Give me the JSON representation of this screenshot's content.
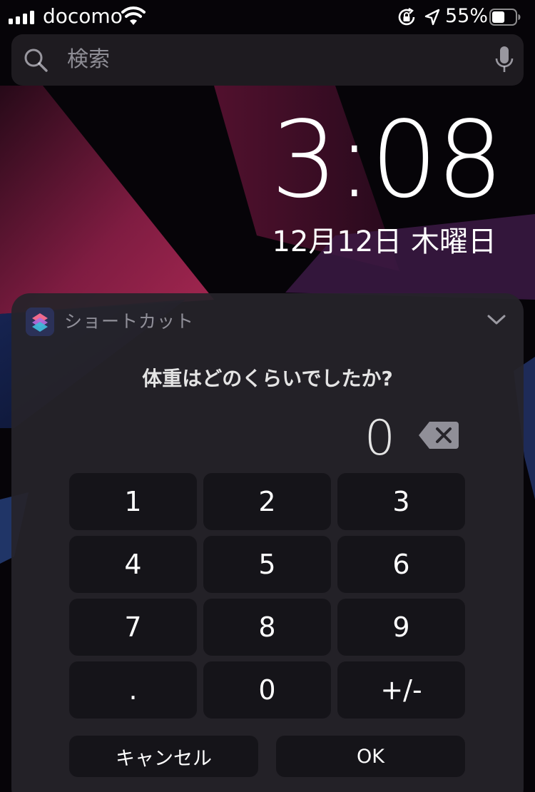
{
  "status_bar": {
    "carrier": "docomo",
    "battery_percent": "55%",
    "battery_level": 0.55,
    "signal_bars": 4,
    "icons": [
      "signal-icon",
      "wifi-icon",
      "rotation-lock-icon",
      "location-arrow-icon",
      "battery-icon"
    ]
  },
  "search": {
    "placeholder": "検索",
    "icons": [
      "search-icon",
      "microphone-icon"
    ]
  },
  "lock_screen": {
    "time": "3:08",
    "date": "12月12日 木曜日"
  },
  "shortcut_card": {
    "app_name": "ショートカット",
    "question": "体重はどのくらいでしたか?",
    "current_value": "0",
    "keys": [
      "1",
      "2",
      "3",
      "4",
      "5",
      "6",
      "7",
      "8",
      "9",
      ".",
      "0",
      "+/-"
    ],
    "cancel_label": "キャンセル",
    "ok_label": "OK",
    "icons": [
      "shortcuts-app-icon",
      "chevron-down-icon",
      "backspace-icon"
    ]
  },
  "colors": {
    "card_background": "#26242a",
    "key_background": "#121116",
    "wallpaper_accent": "#a8234e"
  }
}
